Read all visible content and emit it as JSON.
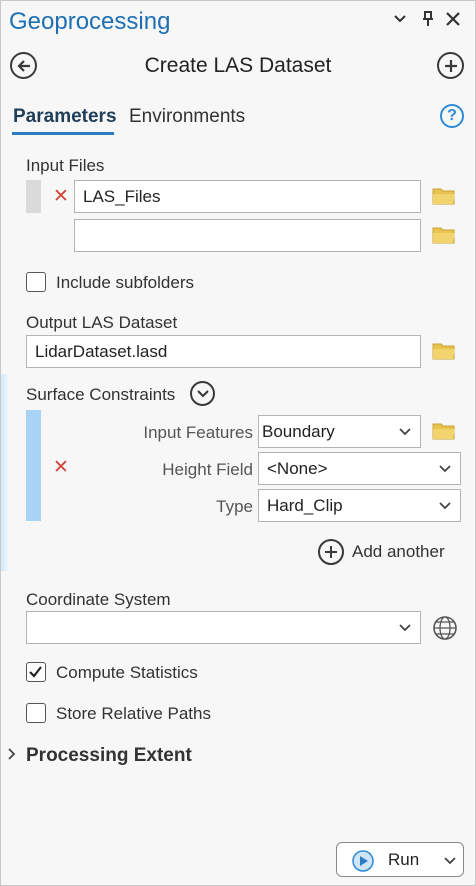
{
  "pane": {
    "title": "Geoprocessing"
  },
  "tool": {
    "title": "Create LAS Dataset"
  },
  "tabs": [
    {
      "label": "Parameters"
    },
    {
      "label": "Environments"
    }
  ],
  "help": {
    "glyph": "?"
  },
  "input_files": {
    "label": "Input Files",
    "rows": [
      {
        "value": "LAS_Files"
      },
      {
        "value": ""
      }
    ]
  },
  "include_subfolders": {
    "label": "Include subfolders",
    "checked": false
  },
  "output": {
    "label": "Output LAS Dataset",
    "value": "LidarDataset.lasd"
  },
  "surface_constraints": {
    "label": "Surface Constraints",
    "input_features_label": "Input Features",
    "input_features_value": "Boundary",
    "height_field_label": "Height Field",
    "height_field_value": "<None>",
    "type_label": "Type",
    "type_value": "Hard_Clip",
    "add_another": "Add another"
  },
  "coordinate_system": {
    "label": "Coordinate System",
    "value": ""
  },
  "compute_statistics": {
    "label": "Compute Statistics",
    "checked": true
  },
  "store_relative_paths": {
    "label": "Store Relative Paths",
    "checked": false
  },
  "processing_extent": {
    "label": "Processing Extent"
  },
  "run": {
    "label": "Run"
  },
  "colors": {
    "accent": "#2e7bc4",
    "title": "#1f6fb5",
    "folder": "#e8c352",
    "remove": "#d1453b",
    "constraint_strip": "#a8d3f4"
  }
}
